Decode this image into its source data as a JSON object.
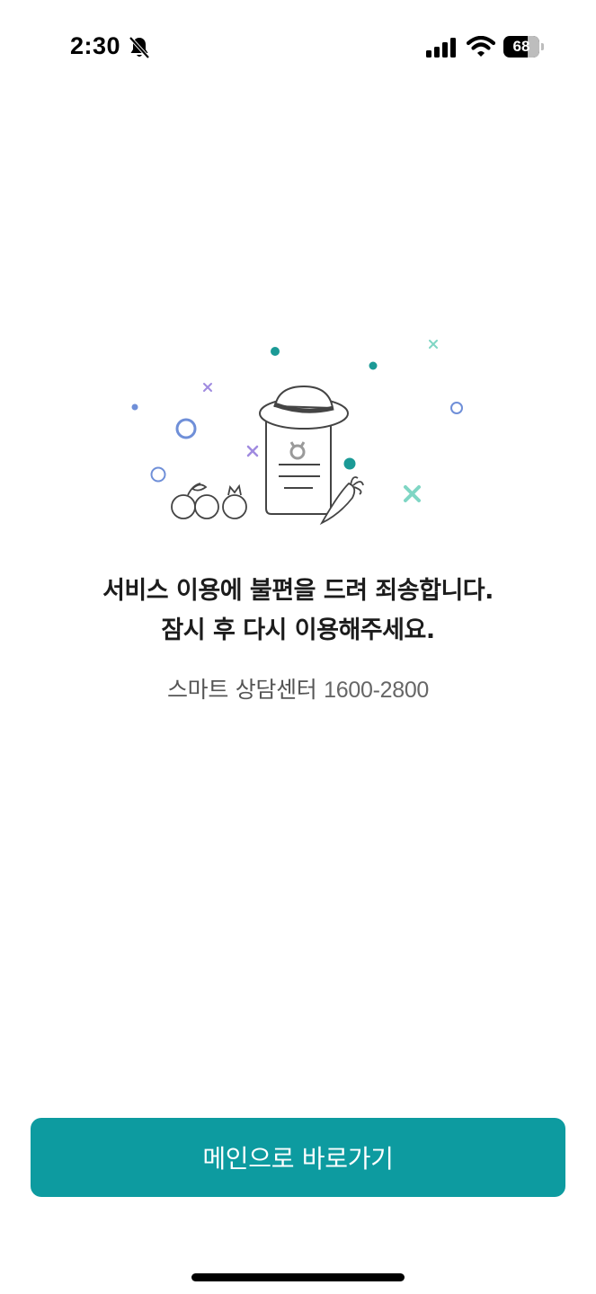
{
  "status_bar": {
    "time": "2:30",
    "battery_percent": "68",
    "battery_level": 0.68
  },
  "icons": {
    "bell": "bell-slash-icon",
    "signal": "cellular-signal-icon",
    "wifi": "wifi-icon"
  },
  "error": {
    "line1": "서비스 이용에 불편을 드려 죄송합니다.",
    "line2": "잠시 후 다시 이용해주세요.",
    "contact_label": "스마트 상담센터",
    "contact_phone": "1600-2800"
  },
  "actions": {
    "main_button_label": "메인으로 바로가기"
  },
  "colors": {
    "accent": "#0d9ba0",
    "illustration_teal": "#1b9a96",
    "illustration_mint": "#7fd6c4",
    "illustration_blue": "#6f8fd8",
    "illustration_purple": "#a08be0",
    "text_primary": "#1c1c1c",
    "text_secondary": "#555555"
  }
}
